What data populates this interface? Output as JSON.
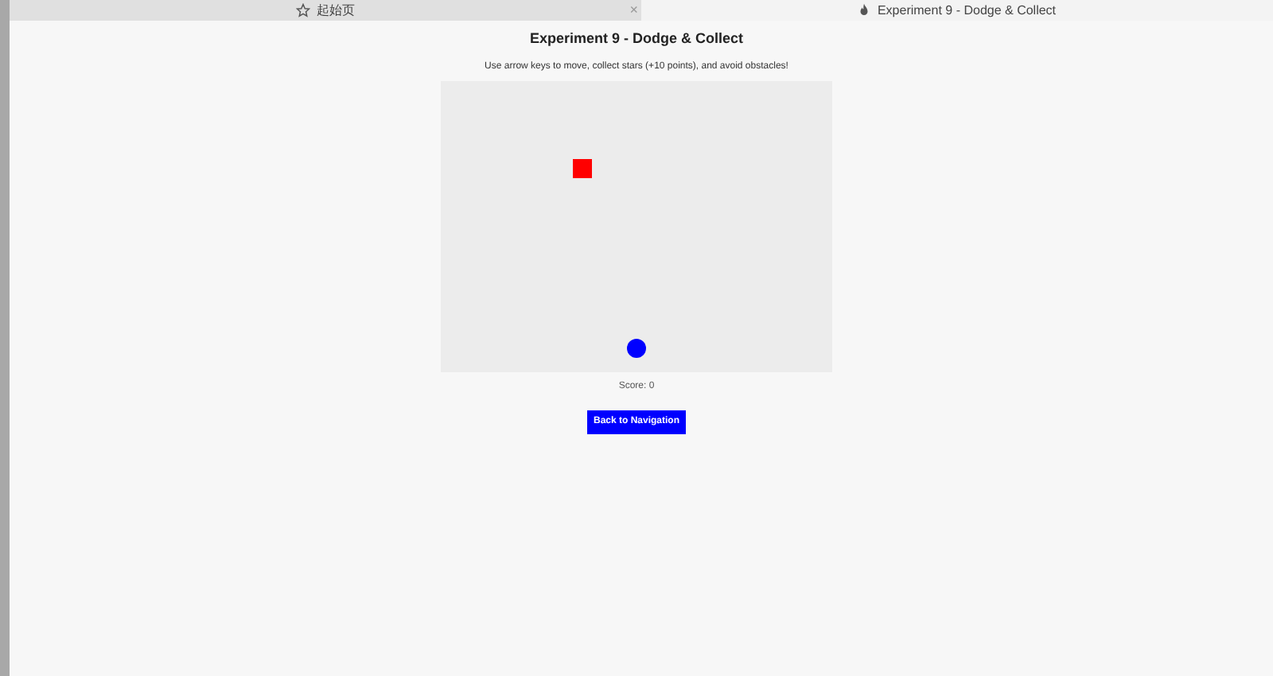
{
  "tabs": [
    {
      "label": "起始页",
      "selected": false,
      "close": "×"
    },
    {
      "label": "Experiment 9 - Dodge & Collect",
      "selected": true
    }
  ],
  "page": {
    "title": "Experiment 9 - Dodge & Collect",
    "instructions": "Use arrow keys to move, collect stars (+10 points), and avoid obstacles!",
    "score": "Score: 0",
    "back_button": "Back to Navigation"
  }
}
